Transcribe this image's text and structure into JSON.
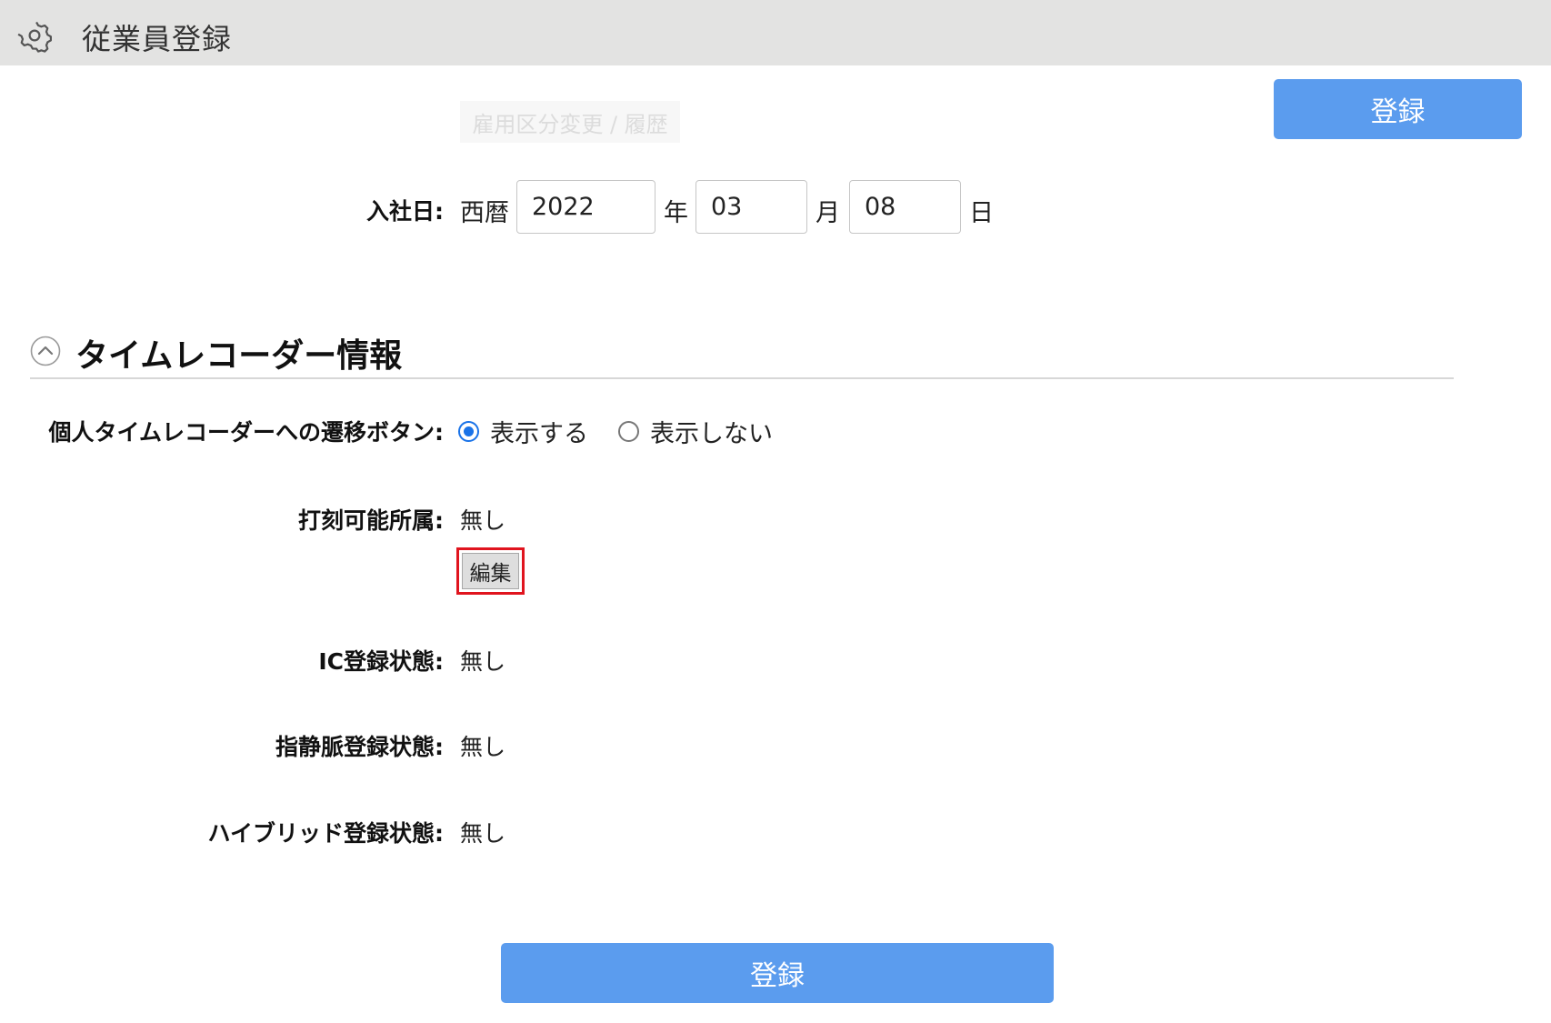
{
  "header": {
    "title": "従業員登録",
    "icon": "gear-icon"
  },
  "top_register_label": "登録",
  "employment_history_link": "雇用区分変更 / 履歴",
  "join_date": {
    "label": "入社日:",
    "era_label": "西暦",
    "year": "2022",
    "year_unit": "年",
    "month": "03",
    "month_unit": "月",
    "day": "08",
    "day_unit": "日"
  },
  "timerecorder_section": {
    "title": "タイムレコーダー情報",
    "toggle_icon": "chevron-up-icon",
    "transition_button": {
      "label": "個人タイムレコーダーへの遷移ボタン:",
      "options": [
        {
          "label": "表示する",
          "checked": true
        },
        {
          "label": "表示しない",
          "checked": false
        }
      ]
    },
    "clock_affiliation": {
      "label": "打刻可能所属:",
      "value": "無し",
      "edit_label": "編集"
    },
    "ic_status": {
      "label": "IC登録状態:",
      "value": "無し"
    },
    "vein_status": {
      "label": "指静脈登録状態:",
      "value": "無し"
    },
    "hybrid_status": {
      "label": "ハイブリッド登録状態:",
      "value": "無し"
    }
  },
  "bottom_register_label": "登録",
  "colors": {
    "primary_button": "#5b9cee",
    "header_bg": "#e3e3e2",
    "highlight_border": "#e0141e",
    "radio_checked": "#1a73e8"
  }
}
